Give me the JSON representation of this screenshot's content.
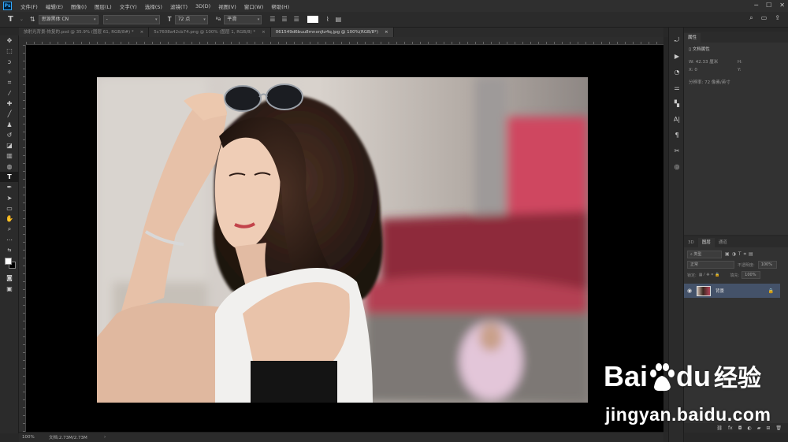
{
  "menubar": {
    "logo": "Ps",
    "items": [
      "文件(F)",
      "编辑(E)",
      "图像(I)",
      "图层(L)",
      "文字(Y)",
      "选择(S)",
      "滤镜(T)",
      "3D(D)",
      "视图(V)",
      "窗口(W)",
      "帮助(H)"
    ]
  },
  "options": {
    "font_family": "思源黑体 CN",
    "font_style": "-",
    "font_size": "72 点",
    "antialias": "平滑"
  },
  "tabs": [
    {
      "label": "放射光背景-恢复的.psd @ 35.9% (图层 61, RGB/8#) *",
      "close": "×"
    },
    {
      "label": "5c7608a42cb74.png @ 100% (图层 1, RGB/8) *",
      "close": "×"
    },
    {
      "label": "061549d6buu8mnxnjtz4q.jpg @ 100%(RGB/8*)",
      "close": "×"
    }
  ],
  "status": {
    "zoom": "100%",
    "doc": "文档:2.73M/2.73M",
    "arrow": "›"
  },
  "properties": {
    "tab": "属性",
    "title": "文档属性",
    "w_label": "W:",
    "w_value": "42.33 厘米",
    "h_label": "H:",
    "x_label": "X:",
    "x_value": "0",
    "y_label": "Y:",
    "resolution": "分辨率: 72 像素/英寸"
  },
  "layers_panel": {
    "tabs": [
      "3D",
      "图层",
      "通道"
    ],
    "filter": "类型",
    "blend": "正常",
    "opacity_label": "不透明度:",
    "opacity_value": "100%",
    "lock_label": "锁定:",
    "fill_label": "填充:",
    "fill_value": "100%",
    "layer_name": "背景"
  },
  "watermark": {
    "logo_a": "Bai",
    "logo_b": "du",
    "logo_c": "经验",
    "url": "jingyan.baidu.com"
  },
  "colors": {
    "accent": "#31a8ff",
    "selected_layer": "#445269",
    "canvas": "#000000"
  }
}
